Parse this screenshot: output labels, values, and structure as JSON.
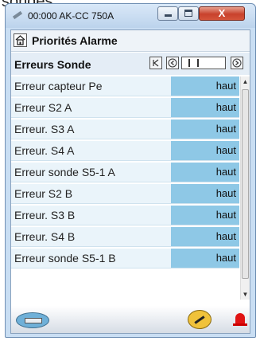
{
  "caption": "sondes",
  "window": {
    "title": "00:000 AK-CC 750A",
    "close_symbol": "X"
  },
  "header": {
    "title": "Priorités Alarme"
  },
  "section": {
    "title": "Erreurs Sonde",
    "nav_first": "|<",
    "nav_prev": "<",
    "nav_next": ">"
  },
  "rows": [
    {
      "label": "Erreur capteur Pe",
      "value": "haut"
    },
    {
      "label": "Erreur S2 A",
      "value": "haut"
    },
    {
      "label": "Erreur. S3 A",
      "value": "haut"
    },
    {
      "label": "Erreur. S4 A",
      "value": "haut"
    },
    {
      "label": "Erreur sonde S5-1 A",
      "value": "haut"
    },
    {
      "label": "Erreur S2 B",
      "value": "haut"
    },
    {
      "label": "Erreur. S3 B",
      "value": "haut"
    },
    {
      "label": "Erreur. S4 B",
      "value": "haut"
    },
    {
      "label": "Erreur sonde S5-1 B",
      "value": "haut"
    }
  ],
  "icons": [
    "home-icon",
    "battery-icon",
    "wrench-icon",
    "alarm-icon"
  ],
  "colors": {
    "value_cell": "#8ec8e6",
    "row_bg": "#eaf4fa",
    "alarm": "#e01414"
  }
}
